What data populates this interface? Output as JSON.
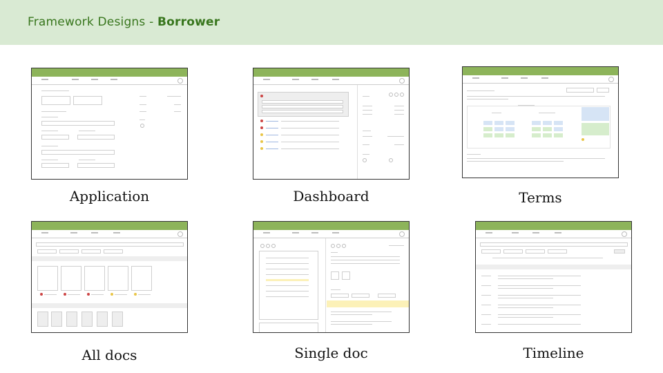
{
  "header": {
    "title_prefix": "Framework Designs - ",
    "title_bold": "Borrower"
  },
  "colors": {
    "banner_bg": "#d9ead3",
    "title_text": "#38761d",
    "mockup_topbar": "#8db45a"
  },
  "screens": [
    {
      "label": "Application"
    },
    {
      "label": "Dashboard"
    },
    {
      "label": "Terms"
    },
    {
      "label": "All docs"
    },
    {
      "label": "Single doc"
    },
    {
      "label": "Timeline"
    }
  ]
}
